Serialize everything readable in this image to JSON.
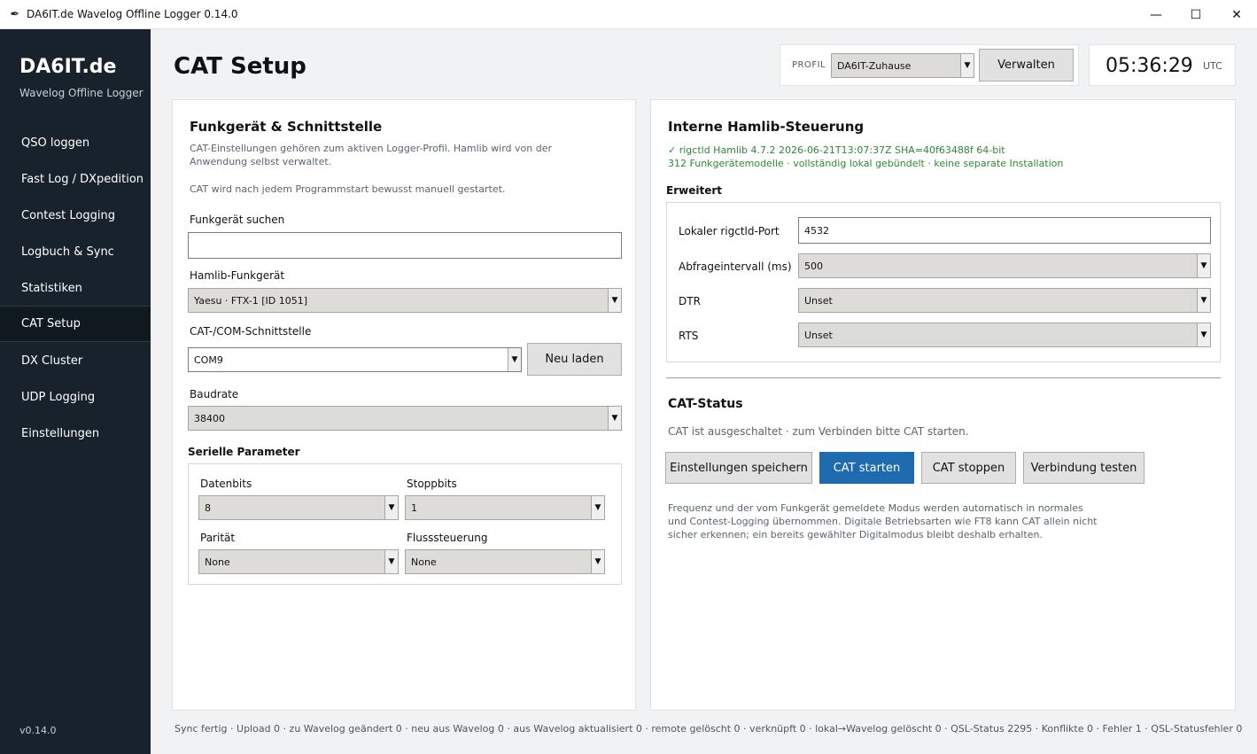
{
  "window": {
    "title": "DA6IT.de Wavelog Offline Logger 0.14.0",
    "icon": "quill-icon",
    "controls": {
      "minimize": "—",
      "maximize": "☐",
      "close": "✕"
    }
  },
  "sidebar": {
    "brand": "DA6IT.de",
    "subtitle": "Wavelog Offline Logger",
    "items": [
      {
        "label": "QSO loggen"
      },
      {
        "label": "Fast Log / DXpedition"
      },
      {
        "label": "Contest Logging"
      },
      {
        "label": "Logbuch & Sync"
      },
      {
        "label": "Statistiken"
      },
      {
        "label": "CAT Setup",
        "active": true
      },
      {
        "label": "DX Cluster"
      },
      {
        "label": "UDP Logging"
      },
      {
        "label": "Einstellungen"
      }
    ],
    "version": "v0.14.0"
  },
  "header": {
    "title": "CAT Setup",
    "profile_label": "PROFIL",
    "profile_value": "DA6IT-Zuhause",
    "manage_label": "Verwalten",
    "clock": "05:36:29",
    "clock_tz": "UTC"
  },
  "left_panel": {
    "title": "Funkgerät & Schnittstelle",
    "desc1": "CAT-Einstellungen gehören zum aktiven Logger-Profil. Hamlib wird von der",
    "desc2": "Anwendung selbst verwaltet.",
    "desc3": "CAT wird nach jedem Programmstart bewusst manuell gestartet.",
    "search_label": "Funkgerät suchen",
    "search_value": "",
    "rig_label": "Hamlib-Funkgerät",
    "rig_value": "Yaesu · FTX-1 [ID 1051]",
    "port_label": "CAT-/COM-Schnittstelle",
    "port_value": "COM9",
    "reload_label": "Neu laden",
    "baud_label": "Baudrate",
    "baud_value": "38400",
    "serial_title": "Serielle Parameter",
    "databits_label": "Datenbits",
    "databits_value": "8",
    "stopbits_label": "Stoppbits",
    "stopbits_value": "1",
    "parity_label": "Parität",
    "parity_value": "None",
    "flow_label": "Flusssteuerung",
    "flow_value": "None"
  },
  "right_panel": {
    "title": "Interne Hamlib-Steuerung",
    "status_line1": "✓ rigctld Hamlib 4.7.2 2026-06-21T13:07:37Z SHA=40f63488f 64-bit",
    "status_line2": "312 Funkgerätemodelle · vollständig lokal gebündelt · keine separate Installation",
    "advanced_title": "Erweitert",
    "port_label": "Lokaler rigctld-Port",
    "port_value": "4532",
    "poll_label": "Abfrageintervall (ms)",
    "poll_value": "500",
    "dtr_label": "DTR",
    "dtr_value": "Unset",
    "rts_label": "RTS",
    "rts_value": "Unset",
    "cat_status_title": "CAT-Status",
    "cat_status_text": "CAT ist ausgeschaltet · zum Verbinden bitte CAT starten.",
    "btn_save": "Einstellungen speichern",
    "btn_start": "CAT starten",
    "btn_stop": "CAT stoppen",
    "btn_test": "Verbindung testen",
    "info1": "Frequenz und der vom Funkgerät gemeldete Modus werden automatisch in normales",
    "info2": "und Contest-Logging übernommen. Digitale Betriebsarten wie FT8 kann CAT allein nicht",
    "info3": "sicher erkennen; ein bereits gewählter Digitalmodus bleibt deshalb erhalten."
  },
  "statusbar": {
    "text": "Sync fertig · Upload 0 · zu Wavelog geändert 0 · neu aus Wavelog 0 · aus Wavelog aktualisiert 0 · remote gelöscht 0 · verknüpft 0 · lokal→Wavelog gelöscht 0 · QSL-Status 2295 · Konflikte 0 · Fehler 1 · QSL-Statusfehler 0"
  },
  "colors": {
    "sidebar": "#17222c",
    "primary": "#1e6bb0",
    "ok": "#2d8a33"
  }
}
